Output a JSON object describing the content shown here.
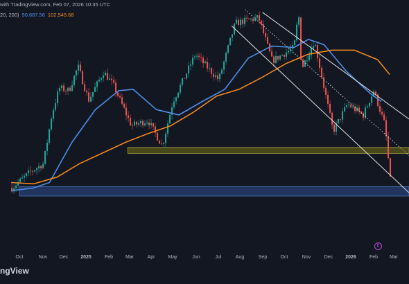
{
  "header": {
    "text": "with TradingView.com, Feb 07, 2026 10:35 UTC"
  },
  "legend": {
    "prefix": "20, 200)",
    "ma_fast_value": "90,687.56",
    "ma_slow_value": "102,545.68"
  },
  "footer": {
    "brand": "ngView"
  },
  "event_badge": {
    "symbol": "£"
  },
  "colors": {
    "background": "#131722",
    "candle_up": "#26a69a",
    "candle_down": "#ef5350",
    "ma_fast": "#4f8fe8",
    "ma_slow": "#f0891f",
    "support_zone": "#2e4f8f",
    "resistance_zone": "#5c5a1a",
    "channel": "#e6e6e6",
    "axis_text": "#b2b5be",
    "event": "#b84dd6"
  },
  "chart_data": {
    "type": "line",
    "title": "",
    "xlabel": "",
    "ylabel": "",
    "x_ticks": [
      "Oct",
      "Nov",
      "Dec",
      "2025",
      "Feb",
      "Mar",
      "Apr",
      "May",
      "Jun",
      "Jul",
      "Aug",
      "Sep",
      "Oct",
      "Nov",
      "Dec",
      "2026",
      "Feb",
      "Mar"
    ],
    "price_range": [
      48000,
      128000
    ],
    "price_series": [
      {
        "date": "2024-09-20",
        "price": 61000
      },
      {
        "date": "2024-10-15",
        "price": 67000
      },
      {
        "date": "2024-11-01",
        "price": 70000
      },
      {
        "date": "2024-11-12",
        "price": 88000
      },
      {
        "date": "2024-11-22",
        "price": 98000
      },
      {
        "date": "2024-12-05",
        "price": 97000
      },
      {
        "date": "2024-12-17",
        "price": 106000
      },
      {
        "date": "2024-12-31",
        "price": 93500
      },
      {
        "date": "2025-01-20",
        "price": 104000
      },
      {
        "date": "2025-02-02",
        "price": 99000
      },
      {
        "date": "2025-02-26",
        "price": 84000
      },
      {
        "date": "2025-03-20",
        "price": 86000
      },
      {
        "date": "2025-04-08",
        "price": 76500
      },
      {
        "date": "2025-04-22",
        "price": 93000
      },
      {
        "date": "2025-05-22",
        "price": 110500
      },
      {
        "date": "2025-06-22",
        "price": 101000
      },
      {
        "date": "2025-07-14",
        "price": 122000
      },
      {
        "date": "2025-08-14",
        "price": 124000
      },
      {
        "date": "2025-09-01",
        "price": 108000
      },
      {
        "date": "2025-09-30",
        "price": 113000
      },
      {
        "date": "2025-10-06",
        "price": 126000
      },
      {
        "date": "2025-10-10",
        "price": 105000
      },
      {
        "date": "2025-10-27",
        "price": 115500
      },
      {
        "date": "2025-11-21",
        "price": 82000
      },
      {
        "date": "2025-12-10",
        "price": 92000
      },
      {
        "date": "2025-12-31",
        "price": 88000
      },
      {
        "date": "2026-01-14",
        "price": 97000
      },
      {
        "date": "2026-01-29",
        "price": 84000
      },
      {
        "date": "2026-02-06",
        "price": 61000
      },
      {
        "date": "2026-02-07",
        "price": 68000
      }
    ],
    "series": [
      {
        "name": "MA 200",
        "indicator": "moving average (fast)",
        "points": [
          {
            "date": "2024-09-20",
            "price": 60000
          },
          {
            "date": "2024-10-20",
            "price": 61000
          },
          {
            "date": "2024-11-10",
            "price": 63000
          },
          {
            "date": "2024-12-10",
            "price": 78000
          },
          {
            "date": "2025-01-10",
            "price": 90000
          },
          {
            "date": "2025-02-10",
            "price": 97000
          },
          {
            "date": "2025-03-01",
            "price": 97500
          },
          {
            "date": "2025-04-01",
            "price": 90000
          },
          {
            "date": "2025-05-01",
            "price": 88000
          },
          {
            "date": "2025-06-01",
            "price": 93000
          },
          {
            "date": "2025-07-01",
            "price": 97500
          },
          {
            "date": "2025-08-01",
            "price": 109000
          },
          {
            "date": "2025-09-01",
            "price": 113500
          },
          {
            "date": "2025-10-01",
            "price": 113000
          },
          {
            "date": "2025-10-20",
            "price": 116000
          },
          {
            "date": "2025-11-10",
            "price": 114000
          },
          {
            "date": "2025-12-10",
            "price": 104000
          },
          {
            "date": "2026-01-10",
            "price": 96000
          },
          {
            "date": "2026-01-25",
            "price": 93000
          }
        ]
      },
      {
        "name": "MA 200",
        "indicator": "moving average (slow)",
        "points": [
          {
            "date": "2024-09-20",
            "price": 63000
          },
          {
            "date": "2024-10-20",
            "price": 62500
          },
          {
            "date": "2024-11-20",
            "price": 65000
          },
          {
            "date": "2024-12-20",
            "price": 70000
          },
          {
            "date": "2025-01-20",
            "price": 74000
          },
          {
            "date": "2025-02-20",
            "price": 78000
          },
          {
            "date": "2025-03-20",
            "price": 81000
          },
          {
            "date": "2025-04-20",
            "price": 84000
          },
          {
            "date": "2025-05-20",
            "price": 89000
          },
          {
            "date": "2025-06-20",
            "price": 95000
          },
          {
            "date": "2025-07-20",
            "price": 97500
          },
          {
            "date": "2025-08-20",
            "price": 102000
          },
          {
            "date": "2025-09-20",
            "price": 107000
          },
          {
            "date": "2025-10-20",
            "price": 110500
          },
          {
            "date": "2025-11-20",
            "price": 112000
          },
          {
            "date": "2025-12-20",
            "price": 112000
          },
          {
            "date": "2026-01-20",
            "price": 108500
          },
          {
            "date": "2026-02-05",
            "price": 103000
          }
        ]
      }
    ],
    "zones": [
      {
        "name": "support",
        "price_low": 58000,
        "price_high": 61500,
        "start": "2024-10-01",
        "end": "2026-03-15"
      },
      {
        "name": "resistance",
        "price_low": 73800,
        "price_high": 76000,
        "start": "2025-02-22",
        "end": "2026-03-15"
      }
    ],
    "trendlines": [
      {
        "name": "channel-upper",
        "style": "solid",
        "start": {
          "date": "2025-08-20",
          "price": 126000
        },
        "end": {
          "date": "2026-03-15",
          "price": 84000
        }
      },
      {
        "name": "channel-mid",
        "style": "dotted",
        "start": {
          "date": "2025-07-28",
          "price": 127000
        },
        "end": {
          "date": "2026-03-15",
          "price": 70000
        }
      },
      {
        "name": "channel-lower",
        "style": "solid",
        "start": {
          "date": "2025-07-10",
          "price": 121000
        },
        "end": {
          "date": "2026-03-15",
          "price": 56000
        }
      }
    ]
  }
}
